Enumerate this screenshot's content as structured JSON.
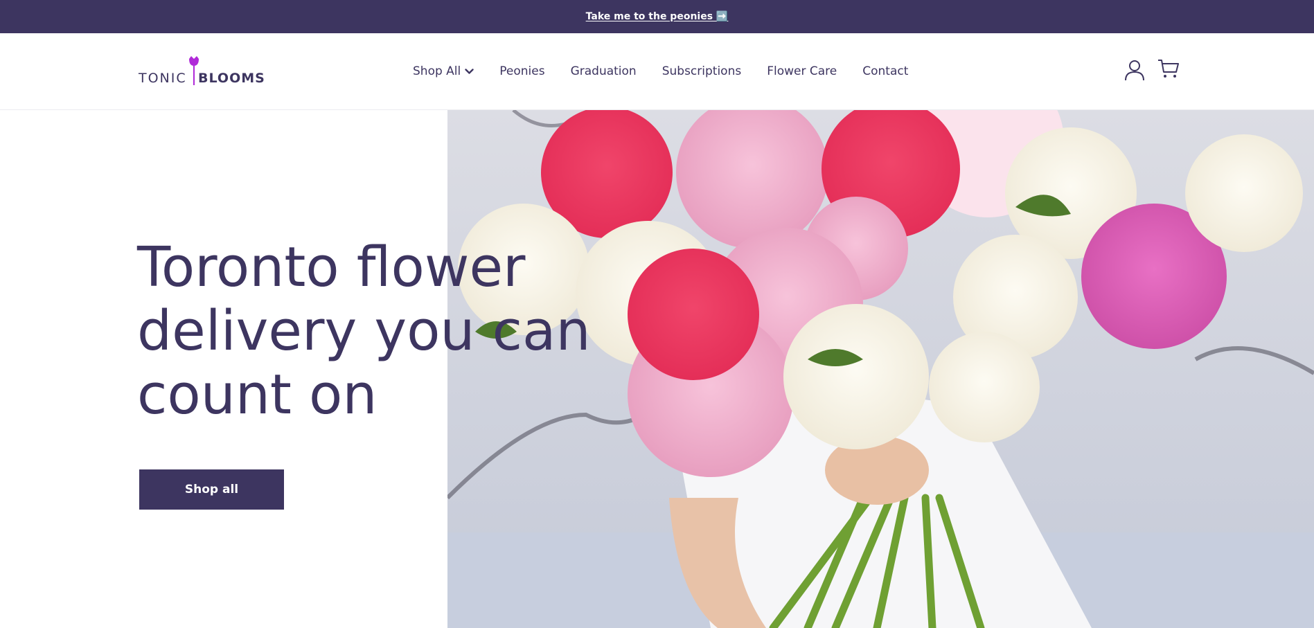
{
  "announcement": {
    "text": "Take me to the peonies ➡️"
  },
  "brand": {
    "part1": "TONIC",
    "part2": "BLOOMS",
    "accent_color": "#b02ad8",
    "primary_color": "#3d3560"
  },
  "nav": {
    "items": [
      {
        "label": "Shop All",
        "has_dropdown": true
      },
      {
        "label": "Peonies"
      },
      {
        "label": "Graduation"
      },
      {
        "label": "Subscriptions"
      },
      {
        "label": "Flower Care"
      },
      {
        "label": "Contact"
      }
    ]
  },
  "header_icons": {
    "account": "user-icon",
    "cart": "cart-icon"
  },
  "hero": {
    "headline_lines": [
      "Toronto flower",
      "delivery you can",
      "count on"
    ],
    "cta_label": "Shop all",
    "image": "bouquet-of-pink-and-white-peonies"
  }
}
